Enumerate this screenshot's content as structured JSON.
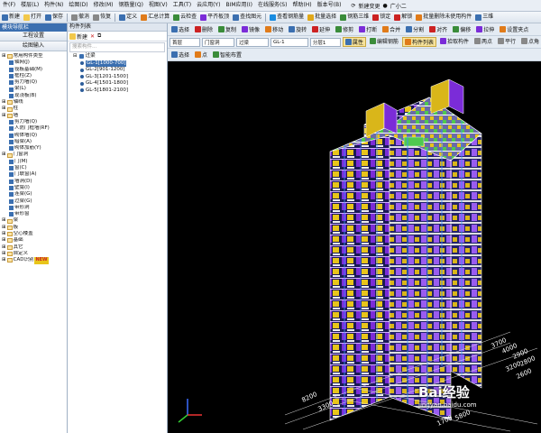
{
  "menubar": {
    "items": [
      "件(F)",
      "楼层(L)",
      "构件(N)",
      "绘图(D)",
      "修改(M)",
      "钢筋量(Q)",
      "视图(V)",
      "工具(T)",
      "云应用(Y)",
      "BIM应用(I)",
      "在线服务(S)",
      "帮助(H)",
      "版本号(B)"
    ],
    "new_change": "新建变更",
    "user": "广小二"
  },
  "toolbar1": {
    "items": [
      "新建",
      "打开",
      "保存",
      "撤消",
      "恢复",
      "定义",
      "汇总计算",
      "云检查",
      "平齐板顶",
      "查找图元",
      "查看钢筋量",
      "批量选择",
      "钢筋三维",
      "锁定",
      "解锁",
      "批量删除未使用构件",
      "三维"
    ]
  },
  "leftpanel": {
    "header": "模块导航栏",
    "btn_project": "工程设置",
    "btn_drawing": "绘图输入",
    "tree": [
      {
        "label": "常用构件类型",
        "level": 0
      },
      {
        "label": "轴网(J)",
        "level": 1
      },
      {
        "label": "筏板基础(M)",
        "level": 1
      },
      {
        "label": "框柱(Z)",
        "level": 1
      },
      {
        "label": "剪力墙(Q)",
        "level": 1
      },
      {
        "label": "梁(L)",
        "level": 1
      },
      {
        "label": "现浇板(B)",
        "level": 1
      },
      {
        "label": "轴线",
        "level": 0
      },
      {
        "label": "柱",
        "level": 0
      },
      {
        "label": "墙",
        "level": 0
      },
      {
        "label": "剪力墙(Q)",
        "level": 1
      },
      {
        "label": "人防门框墙(RF)",
        "level": 1
      },
      {
        "label": "砌体墙(Q)",
        "level": 1
      },
      {
        "label": "暗梁(A)",
        "level": 1
      },
      {
        "label": "砌体加筋(Y)",
        "level": 1
      },
      {
        "label": "门窗洞",
        "level": 0
      },
      {
        "label": "门(M)",
        "level": 1
      },
      {
        "label": "窗(C)",
        "level": 1
      },
      {
        "label": "门联窗(A)",
        "level": 1
      },
      {
        "label": "墙洞(D)",
        "level": 1
      },
      {
        "label": "壁龛(I)",
        "level": 1
      },
      {
        "label": "连梁(G)",
        "level": 1
      },
      {
        "label": "过梁(G)",
        "level": 1
      },
      {
        "label": "带形洞",
        "level": 1
      },
      {
        "label": "带形窗",
        "level": 1
      },
      {
        "label": "梁",
        "level": 0
      },
      {
        "label": "板",
        "level": 0
      },
      {
        "label": "空心楼盖",
        "level": 0
      },
      {
        "label": "基础",
        "level": 0
      },
      {
        "label": "其它",
        "level": 0
      },
      {
        "label": "自定义",
        "level": 0
      },
      {
        "label": "CAD识别",
        "level": 0,
        "badge": "NEW"
      }
    ]
  },
  "midpanel": {
    "header": "构件列表",
    "new_label": "新建",
    "search_placeholder": "搜索构件...",
    "root": "过梁",
    "items": [
      "GL-1[1000-700]",
      "GL-2[901-1200]",
      "GL-3[1201-1500]",
      "GL-4[1501-1800]",
      "GL-5[1801-2100]"
    ]
  },
  "righttop": {
    "row1": [
      "选择",
      "删除",
      "复制",
      "镜像",
      "移动",
      "旋转",
      "延伸",
      "修剪",
      "打断",
      "合并",
      "分割",
      "对齐",
      "偏移",
      "拉伸",
      "设置夹点"
    ],
    "floor": "首层",
    "category": "门窗洞",
    "type": "过梁",
    "component": "GL-1",
    "layer": "分层1",
    "row2_buttons": [
      "属性",
      "编辑钢筋",
      "构件列表",
      "拾取构件",
      "两点",
      "平行",
      "点角"
    ],
    "row3": [
      "选择",
      "点",
      "智能布置"
    ]
  },
  "viewport": {
    "axis_labels": [
      "8200",
      "3300",
      "3700",
      "4000",
      "2900",
      "2800",
      "3200",
      "2600",
      "1700",
      "5800"
    ],
    "watermark": "Bai经验",
    "watermark_url": "jingyan.baidu.com"
  },
  "colors": {
    "accent": "#3b6fb0",
    "purple": "#7b2cd8",
    "yellow": "#e8c51a",
    "green": "#4fc94f"
  }
}
